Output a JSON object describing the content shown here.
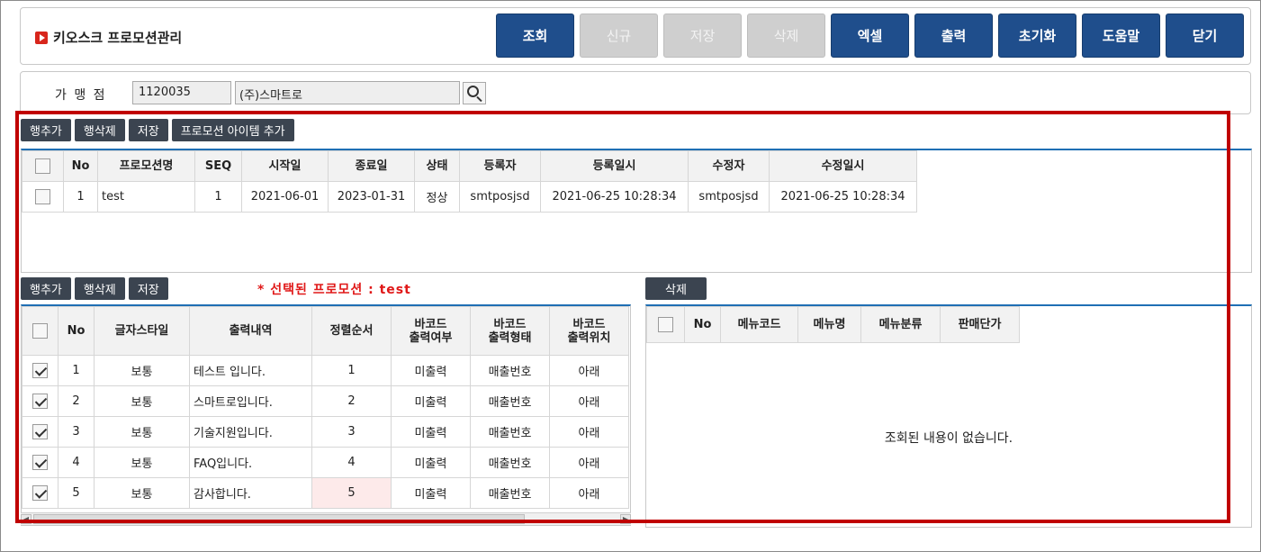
{
  "header": {
    "title": "키오스크 프로모션관리",
    "buttons": [
      {
        "label": "조회",
        "enabled": true
      },
      {
        "label": "신규",
        "enabled": false
      },
      {
        "label": "저장",
        "enabled": false
      },
      {
        "label": "삭제",
        "enabled": false
      },
      {
        "label": "엑셀",
        "enabled": true
      },
      {
        "label": "출력",
        "enabled": true
      },
      {
        "label": "초기화",
        "enabled": true
      },
      {
        "label": "도움말",
        "enabled": true
      },
      {
        "label": "닫기",
        "enabled": true
      }
    ]
  },
  "filter": {
    "label": "가 맹 점",
    "store_code": "1120035",
    "store_name": "(주)스마트로"
  },
  "promotion": {
    "buttons": [
      "행추가",
      "행삭제",
      "저장",
      "프로모션 아이템 추가"
    ],
    "columns": [
      "No",
      "프로모션명",
      "SEQ",
      "시작일",
      "종료일",
      "상태",
      "등록자",
      "등록일시",
      "수정자",
      "수정일시"
    ],
    "rows": [
      {
        "no": "1",
        "name": "test",
        "seq": "1",
        "start": "2021-06-01",
        "end": "2023-01-31",
        "status": "정상",
        "reg_user": "smtposjsd",
        "reg_time": "2021-06-25 10:28:34",
        "mod_user": "smtposjsd",
        "mod_time": "2021-06-25 10:28:34"
      }
    ]
  },
  "text_items": {
    "buttons": [
      "행추가",
      "행삭제",
      "저장"
    ],
    "selected_label": "* 선택된 프로모션 : test",
    "columns": [
      "No",
      "글자스타일",
      "출력내역",
      "정렬순서",
      "바코드\n출력여부",
      "바코드\n출력형태",
      "바코드\n출력위치"
    ],
    "rows": [
      {
        "no": "1",
        "style": "보통",
        "text": "테스트 입니다.",
        "order": "1",
        "print": "미출력",
        "form": "매출번호",
        "pos": "아래"
      },
      {
        "no": "2",
        "style": "보통",
        "text": "스마트로입니다.",
        "order": "2",
        "print": "미출력",
        "form": "매출번호",
        "pos": "아래"
      },
      {
        "no": "3",
        "style": "보통",
        "text": "기술지원입니다.",
        "order": "3",
        "print": "미출력",
        "form": "매출번호",
        "pos": "아래"
      },
      {
        "no": "4",
        "style": "보통",
        "text": "FAQ입니다.",
        "order": "4",
        "print": "미출력",
        "form": "매출번호",
        "pos": "아래"
      },
      {
        "no": "5",
        "style": "보통",
        "text": "감사합니다.",
        "order": "5",
        "print": "미출력",
        "form": "매출번호",
        "pos": "아래"
      }
    ]
  },
  "menu_items": {
    "buttons": [
      "삭제"
    ],
    "columns": [
      "No",
      "메뉴코드",
      "메뉴명",
      "메뉴분류",
      "판매단가"
    ],
    "empty_message": "조회된 내용이 없습니다."
  },
  "colors": {
    "primary": "#1f4e8c",
    "disabled": "#cfcfcf",
    "highlight": "#c00000",
    "dark_button": "#3b4450"
  }
}
